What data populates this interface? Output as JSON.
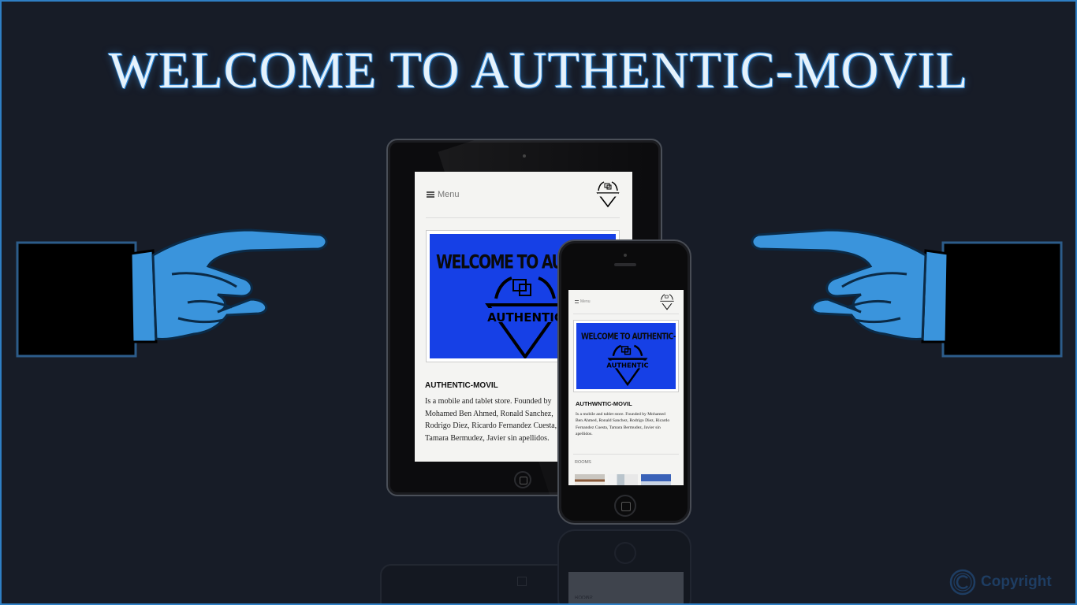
{
  "headline": "WELCOME TO AUTHENTIC-MOVIL",
  "tablet": {
    "menu_label": "Menu",
    "banner_title": "WELCOME TO AUTHENTIC",
    "banner_brand": "AUTHENTIC",
    "heading": "AUTHENTIC-MOVIL",
    "description": "Is a mobile and tablet store. Founded by Mohamed Ben Ahmed, Ronald Sanchez, Rodrigo Diez, Ricardo Fernandez Cuesta, Tamara Bermudez, Javier sin apellidos."
  },
  "phone": {
    "menu_label": "Menu",
    "banner_title": "WELCOME TO AUTHENTIC-MOVIL",
    "banner_brand": "AUTHENTIC",
    "heading": "AUTHWNTIC-MOVIL",
    "description": "Is a mobile and tablet store. Founded by Mohamed Ben Ahmed, Ronald Sanchez, Rodrigo Diez, Ricardo Fernandez Cuesta, Tamara Bermudez, Javier sin apellidos.",
    "section_rooms": "ROOMS"
  },
  "reflection": {
    "rooms_label": "ROOMS"
  },
  "copyright": {
    "label": "Copyright",
    "icon": "copyright-icon"
  },
  "colors": {
    "background": "#171c27",
    "frame_border": "#2f7fc4",
    "hand_blue": "#3a94dc",
    "banner_blue": "#1640e6",
    "headline_glow": "#2d86d4"
  }
}
